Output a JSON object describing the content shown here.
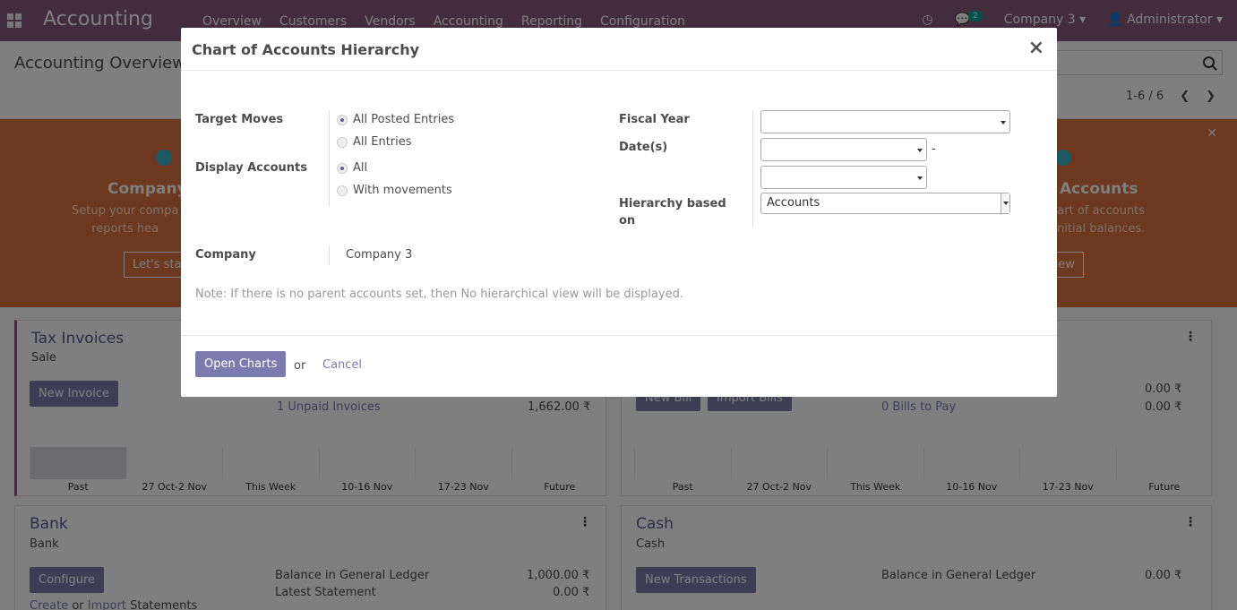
{
  "navbar": {
    "brand": "Accounting",
    "menu": [
      "Overview",
      "Customers",
      "Vendors",
      "Accounting",
      "Reporting",
      "Configuration"
    ],
    "chat_count": "2",
    "company": "Company 3",
    "user": "Administrator"
  },
  "control_panel": {
    "breadcrumb": "Accounting Overview",
    "pager": "1-6 / 6"
  },
  "banner": {
    "left_title": "Company",
    "left_text_1": "Setup your compa",
    "left_text_2": "reports hea",
    "left_button": "Let's sta",
    "right_title": "Accounts",
    "right_text_1": "art of accounts",
    "right_text_2": "nitial balances.",
    "right_button": "view"
  },
  "cards": {
    "tax": {
      "title": "Tax Invoices",
      "subtitle": "Sale",
      "button": "New Invoice",
      "link": "1 Unpaid Invoices",
      "amount": "1,662.00 ₹",
      "graph_labels": [
        "Past",
        "27 Oct-2 Nov",
        "This Week",
        "10-16 Nov",
        "17-23 Nov",
        "Future"
      ]
    },
    "vendor": {
      "button1": "New Bill",
      "button2": "Import Bills",
      "amount1": "0.00 ₹",
      "link": "0 Bills to Pay",
      "amount2": "0.00 ₹",
      "graph_labels": [
        "Past",
        "27 Oct-2 Nov",
        "This Week",
        "10-16 Nov",
        "17-23 Nov",
        "Future"
      ]
    },
    "bank": {
      "title": "Bank",
      "subtitle": "Bank",
      "button": "Configure",
      "line1": "Balance in General Ledger",
      "amount1": "1,000.00 ₹",
      "line2": "Latest Statement",
      "amount2": "0.00 ₹",
      "create": "Create",
      "or": "or",
      "import": "Import",
      "statements": "Statements"
    },
    "cash": {
      "title": "Cash",
      "subtitle": "Cash",
      "button": "New Transactions",
      "line1": "Balance in General Ledger",
      "amount1": "0.00 ₹"
    }
  },
  "modal": {
    "title": "Chart of Accounts Hierarchy",
    "close": "×",
    "target_moves_label": "Target Moves",
    "target_moves_options": [
      "All Posted Entries",
      "All Entries"
    ],
    "target_moves_selected": 0,
    "display_accounts_label": "Display Accounts",
    "display_accounts_options": [
      "All",
      "With movements"
    ],
    "display_accounts_selected": 0,
    "company_label": "Company",
    "company_value": "Company 3",
    "fiscal_year_label": "Fiscal Year",
    "fiscal_year_value": "",
    "dates_label": "Date(s)",
    "date_from": "",
    "date_to": "",
    "date_sep": "-",
    "hierarchy_label": "Hierarchy based on",
    "hierarchy_value": "Accounts",
    "note": "Note: If there is no parent accounts set, then No hierarchical view will be displayed.",
    "open_button": "Open Charts",
    "or_text": "or",
    "cancel": "Cancel"
  }
}
